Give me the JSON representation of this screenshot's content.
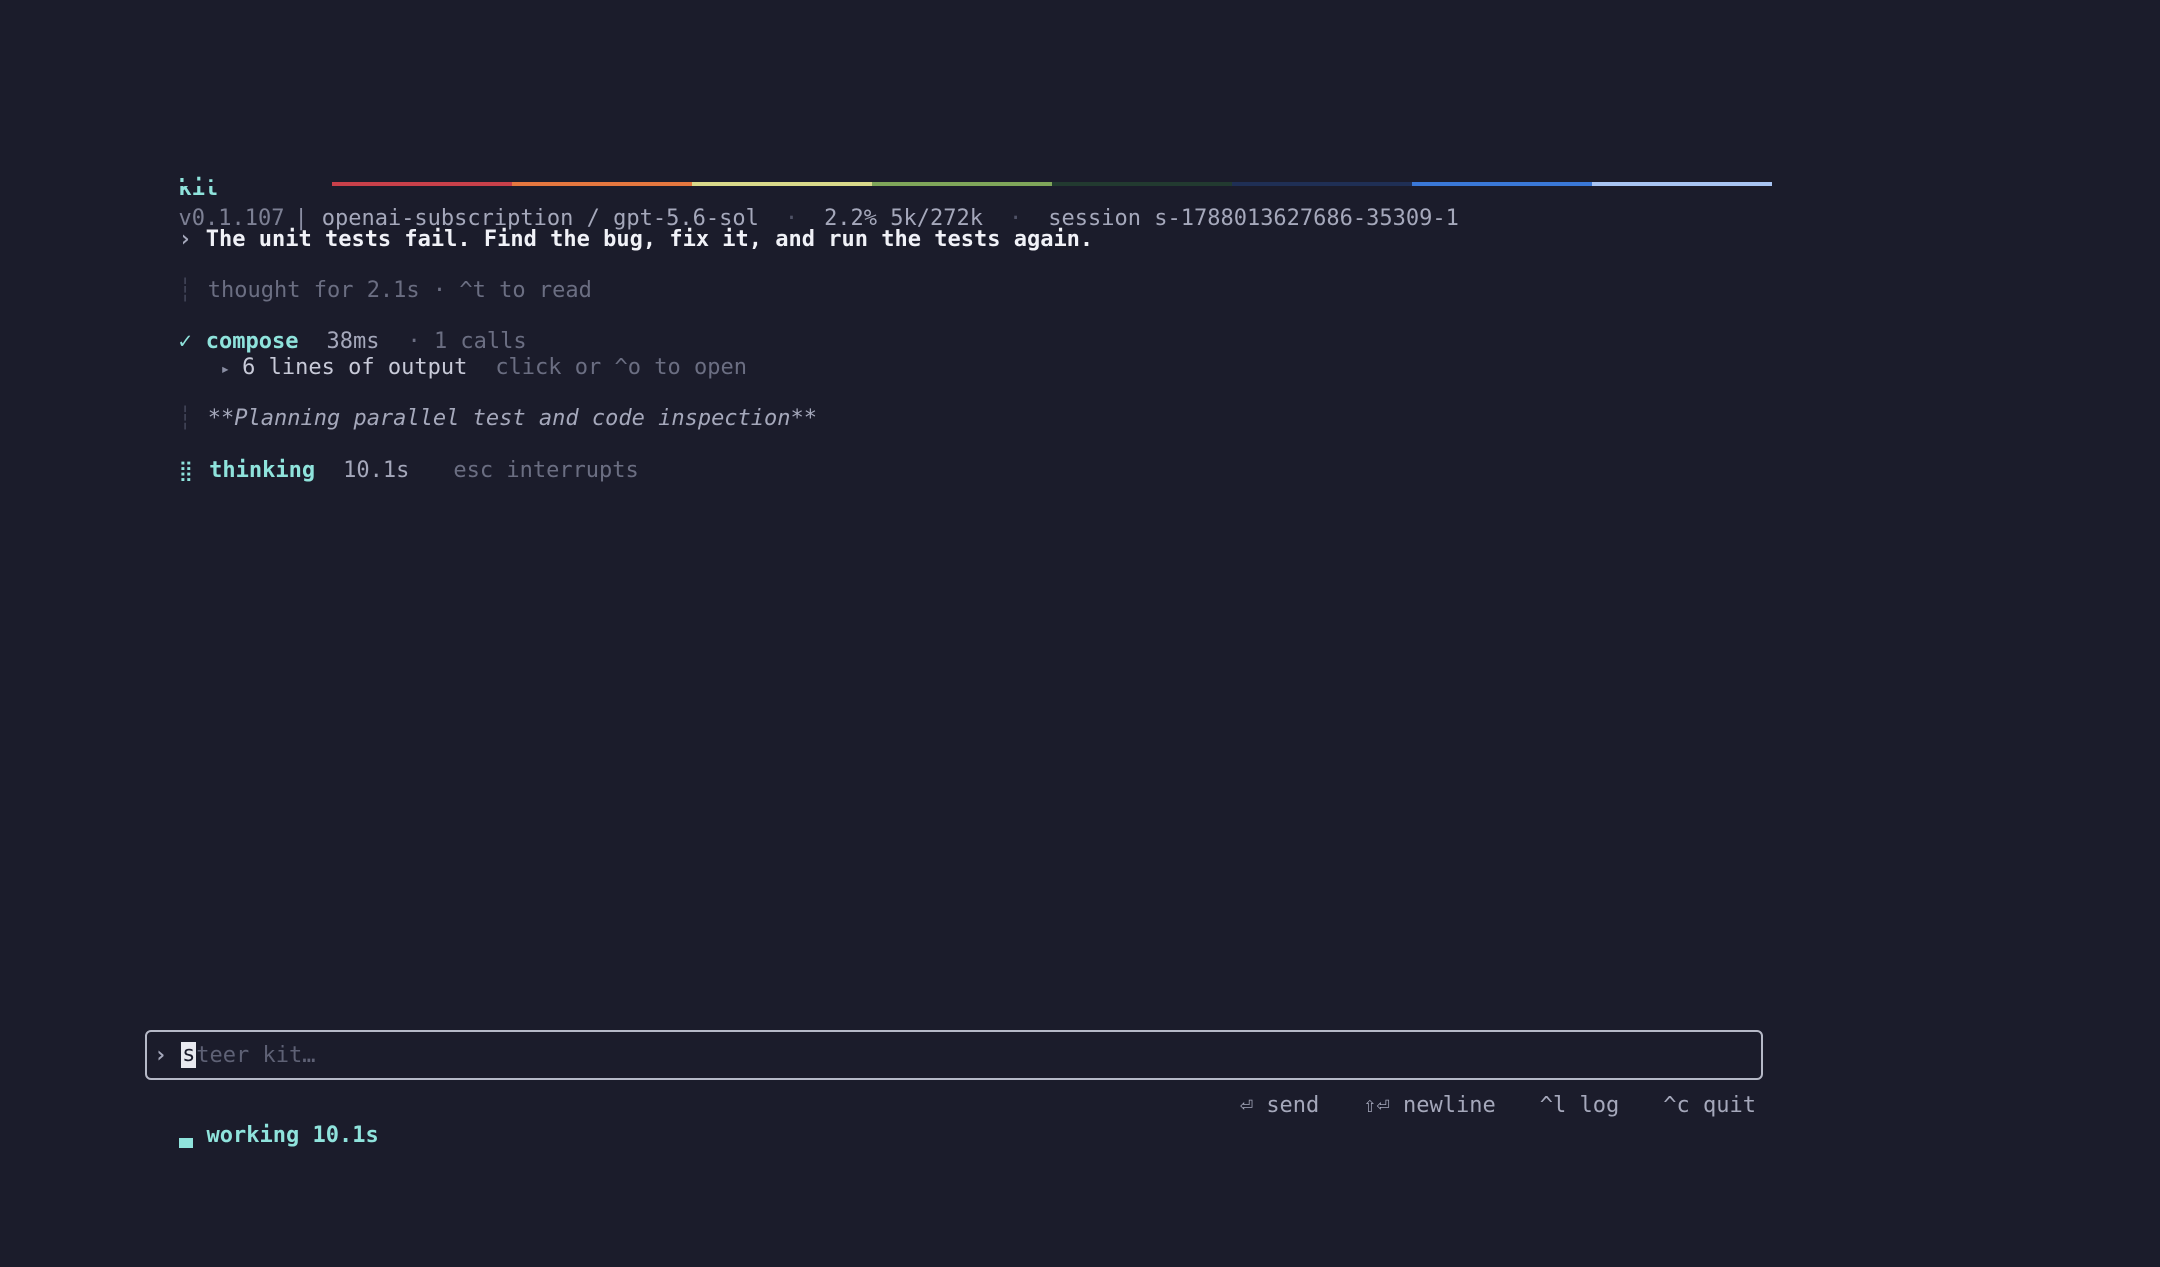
{
  "header": {
    "app_name": "kit",
    "version": "v0.1.107",
    "pipe": "|",
    "provider_model": "openai-subscription / gpt-5.6-sol",
    "separator": "·",
    "context_usage": "2.2% 5k/272k",
    "session": "session s-1788013627686-35309-1"
  },
  "rainbow_colors": [
    "#1b1c2b",
    "#c9404a",
    "#e5773f",
    "#d9d98a",
    "#7fa65a",
    "#223a30",
    "#1f2f55",
    "#3a78d8",
    "#a8c4f2"
  ],
  "transcript": {
    "prompt_caret": "›",
    "user_prompt": "The unit tests fail. Find the bug, fix it, and run the tests again.",
    "thought_bar": "┆",
    "thought": "thought for 2.1s · ^t to read",
    "tool": {
      "check": "✓",
      "name": "compose",
      "duration": "38ms",
      "calls": "· 1 calls",
      "output_toggle": "▸",
      "output_summary": "6 lines of output",
      "output_hint": "click or ^o to open"
    },
    "planning_bar": "┆",
    "planning_text": "**Planning parallel test and code inspection**",
    "thinking": {
      "spinner": "⣿",
      "label": "thinking",
      "duration": "10.1s",
      "hint": "esc interrupts"
    }
  },
  "input": {
    "caret": "›",
    "cursor_char": "s",
    "placeholder_rest": "teer kit…"
  },
  "status": {
    "working": "working 10.1s",
    "hints": [
      {
        "key": "⏎",
        "label": "send"
      },
      {
        "key": "⇧⏎",
        "label": "newline"
      },
      {
        "key": "^l",
        "label": "log"
      },
      {
        "key": "^c",
        "label": "quit"
      }
    ]
  }
}
